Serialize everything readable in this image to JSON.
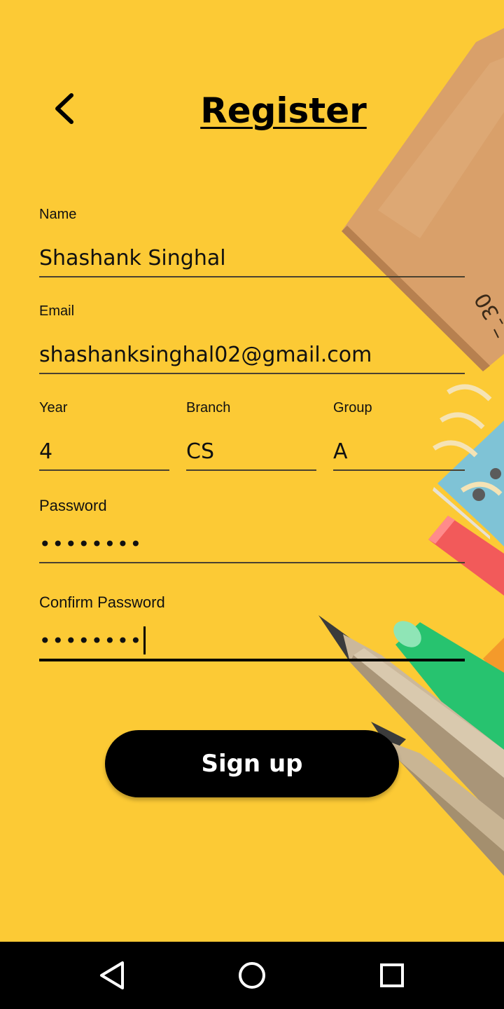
{
  "header": {
    "title": "Register",
    "back_icon": "chevron-left-icon"
  },
  "form": {
    "name": {
      "label": "Name",
      "value": "Shashank Singhal"
    },
    "email": {
      "label": "Email",
      "value": "shashanksinghal02@gmail.com"
    },
    "year": {
      "label": "Year",
      "value": "4"
    },
    "branch": {
      "label": "Branch",
      "value": "CS"
    },
    "group": {
      "label": "Group",
      "value": "A"
    },
    "password": {
      "label": "Password",
      "value": "••••••••"
    },
    "confirm_password": {
      "label": "Confirm Password",
      "value": "••••••••"
    }
  },
  "signup_button": {
    "label": "Sign up"
  },
  "colors": {
    "background": "#fcca35",
    "button": "#000000",
    "button_text": "#ffffff"
  },
  "navbar": {
    "back_icon": "triangle-back-icon",
    "home_icon": "circle-home-icon",
    "recents_icon": "square-recents-icon"
  }
}
